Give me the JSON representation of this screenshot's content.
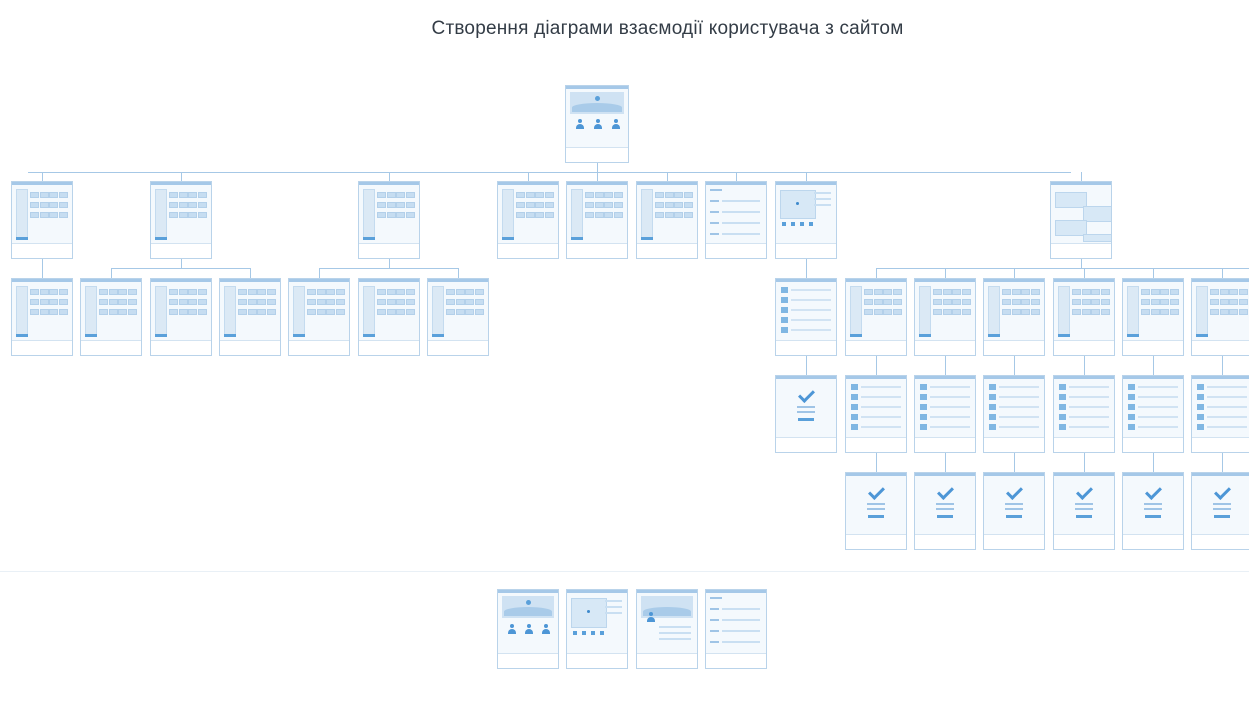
{
  "diagram": {
    "title": "Створення діаграми взаємодії користувача з сайтом",
    "footer_section_label": "",
    "colors": {
      "frame_border": "#b9d3ea",
      "frame_fill": "#f4f9fd",
      "accent": "#4d96d6",
      "connector": "#a6c8e6",
      "title_text": "#333c46"
    },
    "root": {
      "id": "home",
      "variant": "home",
      "caption": ""
    },
    "level1": [
      {
        "id": "l1-catalog",
        "variant": "grid",
        "caption": ""
      },
      {
        "id": "l1-products-a",
        "variant": "grid",
        "caption": ""
      },
      {
        "id": "l1-products-b",
        "variant": "grid",
        "caption": ""
      },
      {
        "id": "l1-page-4",
        "variant": "grid",
        "caption": ""
      },
      {
        "id": "l1-page-5",
        "variant": "grid",
        "caption": ""
      },
      {
        "id": "l1-page-6",
        "variant": "grid",
        "caption": ""
      },
      {
        "id": "l1-form",
        "variant": "form",
        "caption": ""
      },
      {
        "id": "l1-map",
        "variant": "map",
        "caption": ""
      },
      {
        "id": "l1-services",
        "variant": "split",
        "caption": ""
      }
    ],
    "level2_left": [
      {
        "id": "l2-1",
        "variant": "grid",
        "caption": "",
        "parent": "l1-catalog"
      },
      {
        "id": "l2-2",
        "variant": "grid",
        "caption": "",
        "parent": "l1-products-a"
      },
      {
        "id": "l2-3",
        "variant": "grid",
        "caption": "",
        "parent": "l1-products-a"
      },
      {
        "id": "l2-4",
        "variant": "grid",
        "caption": "",
        "parent": "l1-products-a"
      },
      {
        "id": "l2-5",
        "variant": "grid",
        "caption": "",
        "parent": "l1-products-b"
      },
      {
        "id": "l2-6",
        "variant": "grid",
        "caption": "",
        "parent": "l1-products-b"
      },
      {
        "id": "l2-7",
        "variant": "grid",
        "caption": "",
        "parent": "l1-products-b"
      }
    ],
    "map_branch": [
      {
        "id": "mb-list",
        "variant": "list",
        "caption": ""
      },
      {
        "id": "mb-confirm",
        "variant": "confirm",
        "caption": ""
      }
    ],
    "service_columns": [
      {
        "id": "sc-1",
        "grid_caption": "",
        "list_caption": "",
        "confirm_caption": ""
      },
      {
        "id": "sc-2",
        "grid_caption": "",
        "list_caption": "",
        "confirm_caption": ""
      },
      {
        "id": "sc-3",
        "grid_caption": "",
        "list_caption": "",
        "confirm_caption": ""
      },
      {
        "id": "sc-4",
        "grid_caption": "",
        "list_caption": "",
        "confirm_caption": ""
      },
      {
        "id": "sc-5",
        "grid_caption": "",
        "list_caption": "",
        "confirm_caption": ""
      },
      {
        "id": "sc-6",
        "grid_caption": "",
        "list_caption": "",
        "confirm_caption": ""
      }
    ],
    "sitemap_extras": [
      {
        "id": "ex-1",
        "variant": "home",
        "caption": ""
      },
      {
        "id": "ex-2",
        "variant": "map",
        "caption": ""
      },
      {
        "id": "ex-3",
        "variant": "profile",
        "caption": ""
      },
      {
        "id": "ex-4",
        "variant": "form",
        "caption": ""
      }
    ]
  }
}
